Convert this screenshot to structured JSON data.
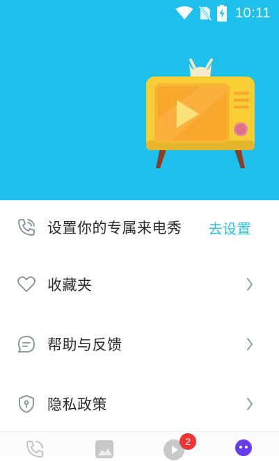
{
  "status_bar": {
    "time": "10:11",
    "icons": [
      "wifi-icon",
      "no-sim-icon",
      "battery-charging-icon"
    ]
  },
  "colors": {
    "hero_background": "#1ec0ec",
    "action_text": "#2dc0dc",
    "icon_stroke": "#7a9294",
    "badge": "#f23434",
    "active_tab": "#6a3cf0"
  },
  "menu": {
    "items": [
      {
        "icon": "phone-ring-icon",
        "label": "设置你的专属来电秀",
        "action": "去设置"
      },
      {
        "icon": "heart-icon",
        "label": "收藏夹",
        "chevron": "chevron-right-icon"
      },
      {
        "icon": "feedback-chat-icon",
        "label": "帮助与反馈",
        "chevron": "chevron-right-icon"
      },
      {
        "icon": "shield-lock-icon",
        "label": "隐私政策",
        "chevron": "chevron-right-icon"
      }
    ]
  },
  "tabbar": {
    "tabs": [
      {
        "icon": "phone-tab-icon"
      },
      {
        "icon": "image-tab-icon"
      },
      {
        "icon": "video-tab-icon",
        "badge": "2"
      },
      {
        "icon": "profile-tab-icon",
        "active": true
      }
    ]
  }
}
